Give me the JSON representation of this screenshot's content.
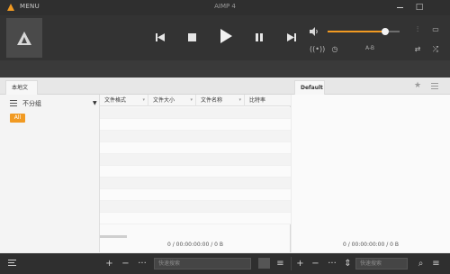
{
  "titlebar": {
    "menu_label": "MENU",
    "app_title": "AIMP 4",
    "minimize_glyph": "",
    "close_glyph": "□"
  },
  "player": {
    "volume_fraction": 0.8,
    "ab_label": "A-B",
    "accent_color": "#f19a22",
    "icons": [
      "prev-icon",
      "stop-icon",
      "play-icon",
      "pause-icon",
      "next-icon",
      "volume-icon",
      "equalizer-icon",
      "visualization-icon",
      "radio-icon",
      "timer-icon",
      "repeat-icon",
      "shuffle-icon"
    ]
  },
  "tabs": {
    "local": "本地文件",
    "default": "Default"
  },
  "library": {
    "group_label": "不分组",
    "all_badge": "All"
  },
  "table": {
    "columns": [
      "文件格式",
      "文件大小",
      "文件名称",
      "比特率"
    ],
    "status": "0 / 00:00:00:00 / 0 B"
  },
  "playlist": {
    "status": "0 / 00:00:00:00 / 0 B"
  },
  "bottombar": {
    "search_placeholder_left": "快速搜索",
    "search_placeholder_right": "快速搜索",
    "add_glyph": "+",
    "remove_glyph": "−",
    "more_glyph": "···"
  }
}
